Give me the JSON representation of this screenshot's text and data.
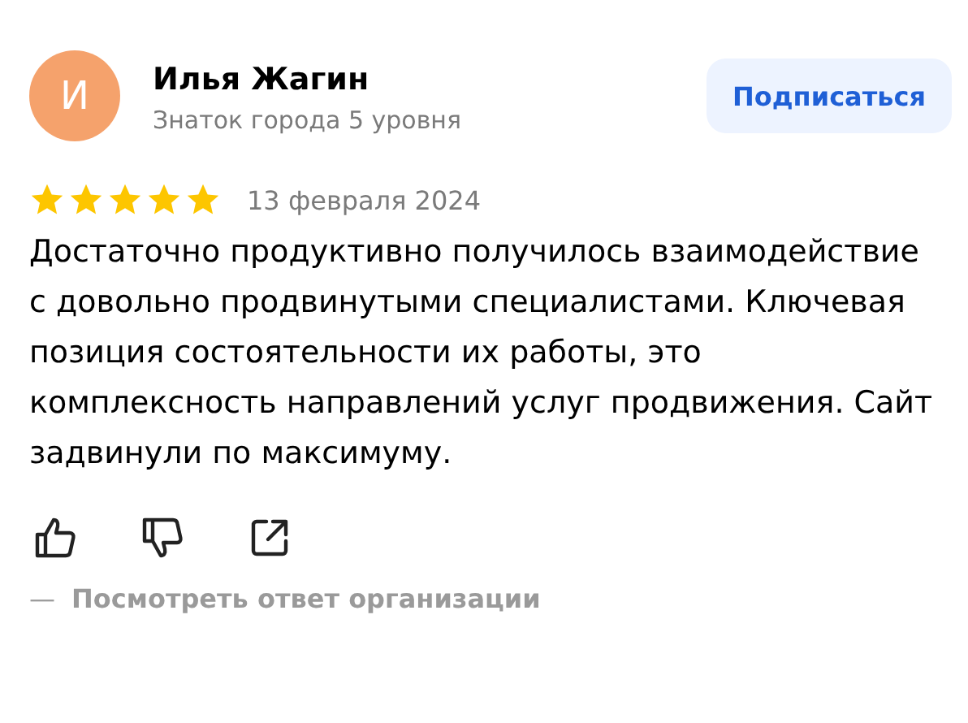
{
  "author": {
    "initial": "И",
    "name": "Илья Жагин",
    "level": "Знаток города 5 уровня"
  },
  "subscribe_button": "Подписаться",
  "rating": {
    "stars": 5
  },
  "date": "13 февраля 2024",
  "text": "Достаточно продуктивно получилось взаимодействие с довольно продвинутыми специалистами. Ключевая позиция состоятельности их работы, это комплексность направлений услуг продвижения. Сайт задвинули по максимуму.",
  "reply_link": {
    "dash": "—",
    "label": "Посмотреть ответ организации"
  }
}
